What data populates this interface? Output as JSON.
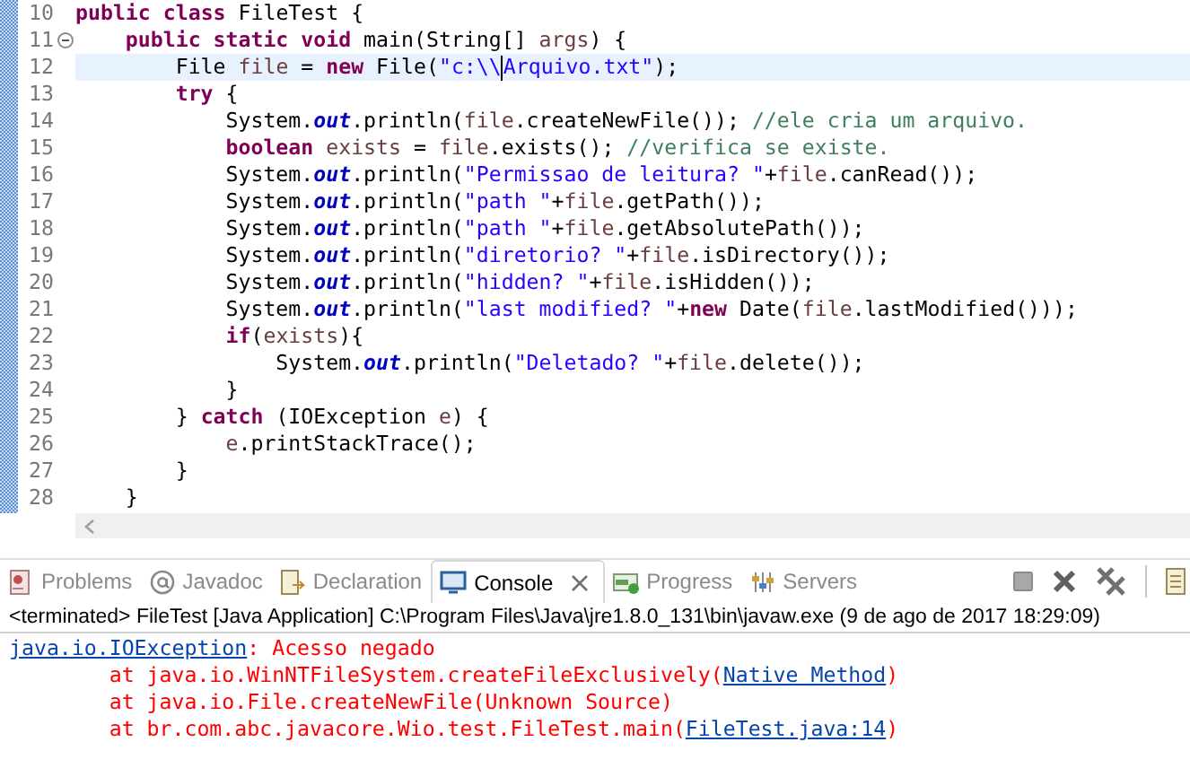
{
  "editor": {
    "lines": [
      {
        "number": "10",
        "current": false,
        "foldable": false,
        "tokens": [
          {
            "kind": "keyword",
            "text": "public "
          },
          {
            "kind": "keyword",
            "text": "class"
          },
          {
            "kind": "plain",
            "text": " FileTest {"
          }
        ]
      },
      {
        "number": "11",
        "current": false,
        "foldable": true,
        "tokens": [
          {
            "kind": "keyword",
            "text": "    public "
          },
          {
            "kind": "keyword",
            "text": "static "
          },
          {
            "kind": "keyword",
            "text": "void"
          },
          {
            "kind": "plain",
            "text": " main(String[] "
          },
          {
            "kind": "var",
            "text": "args"
          },
          {
            "kind": "plain",
            "text": ") {"
          }
        ]
      },
      {
        "number": "12",
        "current": true,
        "foldable": false,
        "tokens": [
          {
            "kind": "plain",
            "text": "        File "
          },
          {
            "kind": "var",
            "text": "file"
          },
          {
            "kind": "plain",
            "text": " = "
          },
          {
            "kind": "keyword",
            "text": "new"
          },
          {
            "kind": "plain",
            "text": " File("
          },
          {
            "kind": "string",
            "text": "\"c:\\\\"
          },
          {
            "kind": "caret"
          },
          {
            "kind": "string",
            "text": "Arquivo.txt\""
          },
          {
            "kind": "plain",
            "text": ");"
          }
        ]
      },
      {
        "number": "13",
        "current": false,
        "foldable": false,
        "tokens": [
          {
            "kind": "keyword",
            "text": "        try"
          },
          {
            "kind": "plain",
            "text": " {"
          }
        ]
      },
      {
        "number": "14",
        "current": false,
        "foldable": false,
        "tokens": [
          {
            "kind": "plain",
            "text": "            System."
          },
          {
            "kind": "field",
            "text": "out"
          },
          {
            "kind": "plain",
            "text": ".println("
          },
          {
            "kind": "var",
            "text": "file"
          },
          {
            "kind": "plain",
            "text": ".createNewFile()); "
          },
          {
            "kind": "comment",
            "text": "//ele cria um arquivo."
          }
        ]
      },
      {
        "number": "15",
        "current": false,
        "foldable": false,
        "tokens": [
          {
            "kind": "keyword",
            "text": "            boolean "
          },
          {
            "kind": "var",
            "text": "exists"
          },
          {
            "kind": "plain",
            "text": " = "
          },
          {
            "kind": "var",
            "text": "file"
          },
          {
            "kind": "plain",
            "text": ".exists(); "
          },
          {
            "kind": "comment",
            "text": "//verifica se existe."
          }
        ]
      },
      {
        "number": "16",
        "current": false,
        "foldable": false,
        "tokens": [
          {
            "kind": "plain",
            "text": "            System."
          },
          {
            "kind": "field",
            "text": "out"
          },
          {
            "kind": "plain",
            "text": ".println("
          },
          {
            "kind": "string",
            "text": "\"Permissao de leitura? \""
          },
          {
            "kind": "plain",
            "text": "+"
          },
          {
            "kind": "var",
            "text": "file"
          },
          {
            "kind": "plain",
            "text": ".canRead());"
          }
        ]
      },
      {
        "number": "17",
        "current": false,
        "foldable": false,
        "tokens": [
          {
            "kind": "plain",
            "text": "            System."
          },
          {
            "kind": "field",
            "text": "out"
          },
          {
            "kind": "plain",
            "text": ".println("
          },
          {
            "kind": "string",
            "text": "\"path \""
          },
          {
            "kind": "plain",
            "text": "+"
          },
          {
            "kind": "var",
            "text": "file"
          },
          {
            "kind": "plain",
            "text": ".getPath());"
          }
        ]
      },
      {
        "number": "18",
        "current": false,
        "foldable": false,
        "tokens": [
          {
            "kind": "plain",
            "text": "            System."
          },
          {
            "kind": "field",
            "text": "out"
          },
          {
            "kind": "plain",
            "text": ".println("
          },
          {
            "kind": "string",
            "text": "\"path \""
          },
          {
            "kind": "plain",
            "text": "+"
          },
          {
            "kind": "var",
            "text": "file"
          },
          {
            "kind": "plain",
            "text": ".getAbsolutePath());"
          }
        ]
      },
      {
        "number": "19",
        "current": false,
        "foldable": false,
        "tokens": [
          {
            "kind": "plain",
            "text": "            System."
          },
          {
            "kind": "field",
            "text": "out"
          },
          {
            "kind": "plain",
            "text": ".println("
          },
          {
            "kind": "string",
            "text": "\"diretorio? \""
          },
          {
            "kind": "plain",
            "text": "+"
          },
          {
            "kind": "var",
            "text": "file"
          },
          {
            "kind": "plain",
            "text": ".isDirectory());"
          }
        ]
      },
      {
        "number": "20",
        "current": false,
        "foldable": false,
        "tokens": [
          {
            "kind": "plain",
            "text": "            System."
          },
          {
            "kind": "field",
            "text": "out"
          },
          {
            "kind": "plain",
            "text": ".println("
          },
          {
            "kind": "string",
            "text": "\"hidden? \""
          },
          {
            "kind": "plain",
            "text": "+"
          },
          {
            "kind": "var",
            "text": "file"
          },
          {
            "kind": "plain",
            "text": ".isHidden());"
          }
        ]
      },
      {
        "number": "21",
        "current": false,
        "foldable": false,
        "tokens": [
          {
            "kind": "plain",
            "text": "            System."
          },
          {
            "kind": "field",
            "text": "out"
          },
          {
            "kind": "plain",
            "text": ".println("
          },
          {
            "kind": "string",
            "text": "\"last modified? \""
          },
          {
            "kind": "plain",
            "text": "+"
          },
          {
            "kind": "keyword",
            "text": "new"
          },
          {
            "kind": "plain",
            "text": " Date("
          },
          {
            "kind": "var",
            "text": "file"
          },
          {
            "kind": "plain",
            "text": ".lastModified()));"
          }
        ]
      },
      {
        "number": "22",
        "current": false,
        "foldable": false,
        "tokens": [
          {
            "kind": "keyword",
            "text": "            if"
          },
          {
            "kind": "plain",
            "text": "("
          },
          {
            "kind": "var",
            "text": "exists"
          },
          {
            "kind": "plain",
            "text": "){"
          }
        ]
      },
      {
        "number": "23",
        "current": false,
        "foldable": false,
        "tokens": [
          {
            "kind": "plain",
            "text": "                System."
          },
          {
            "kind": "field",
            "text": "out"
          },
          {
            "kind": "plain",
            "text": ".println("
          },
          {
            "kind": "string",
            "text": "\"Deletado? \""
          },
          {
            "kind": "plain",
            "text": "+"
          },
          {
            "kind": "var",
            "text": "file"
          },
          {
            "kind": "plain",
            "text": ".delete());"
          }
        ]
      },
      {
        "number": "24",
        "current": false,
        "foldable": false,
        "tokens": [
          {
            "kind": "plain",
            "text": "            }"
          }
        ]
      },
      {
        "number": "25",
        "current": false,
        "foldable": false,
        "tokens": [
          {
            "kind": "plain",
            "text": "        } "
          },
          {
            "kind": "keyword",
            "text": "catch"
          },
          {
            "kind": "plain",
            "text": " (IOException "
          },
          {
            "kind": "var",
            "text": "e"
          },
          {
            "kind": "plain",
            "text": ") {"
          }
        ]
      },
      {
        "number": "26",
        "current": false,
        "foldable": false,
        "tokens": [
          {
            "kind": "var",
            "text": "            e"
          },
          {
            "kind": "plain",
            "text": ".printStackTrace();"
          }
        ]
      },
      {
        "number": "27",
        "current": false,
        "foldable": false,
        "tokens": [
          {
            "kind": "plain",
            "text": "        }"
          }
        ]
      },
      {
        "number": "28",
        "current": false,
        "foldable": false,
        "tokens": [
          {
            "kind": "plain",
            "text": "    }"
          }
        ]
      }
    ]
  },
  "panel": {
    "tabs": [
      {
        "label": "Problems",
        "kind": "problems",
        "selected": false
      },
      {
        "label": "Javadoc",
        "kind": "javadoc",
        "selected": false
      },
      {
        "label": "Declaration",
        "kind": "declaration",
        "selected": false
      },
      {
        "label": "Console",
        "kind": "console",
        "selected": true
      },
      {
        "label": "Progress",
        "kind": "progress",
        "selected": false
      },
      {
        "label": "Servers",
        "kind": "servers",
        "selected": false
      }
    ]
  },
  "console": {
    "header": "<terminated> FileTest [Java Application] C:\\Program Files\\Java\\jre1.8.0_131\\bin\\javaw.exe (9 de ago de 2017 18:29:09)",
    "lines": [
      [
        {
          "kind": "link",
          "text": "java.io.IOException"
        },
        {
          "kind": "error",
          "text": ": Acesso negado"
        }
      ],
      [
        {
          "kind": "error",
          "text": "        at java.io.WinNTFileSystem.createFileExclusively("
        },
        {
          "kind": "link",
          "text": "Native Method"
        },
        {
          "kind": "error",
          "text": ")"
        }
      ],
      [
        {
          "kind": "error",
          "text": "        at java.io.File.createNewFile(Unknown Source)"
        }
      ],
      [
        {
          "kind": "error",
          "text": "        at br.com.abc.javacore.Wio.test.FileTest.main("
        },
        {
          "kind": "link",
          "text": "FileTest.java:14"
        },
        {
          "kind": "error",
          "text": ")"
        }
      ]
    ]
  }
}
